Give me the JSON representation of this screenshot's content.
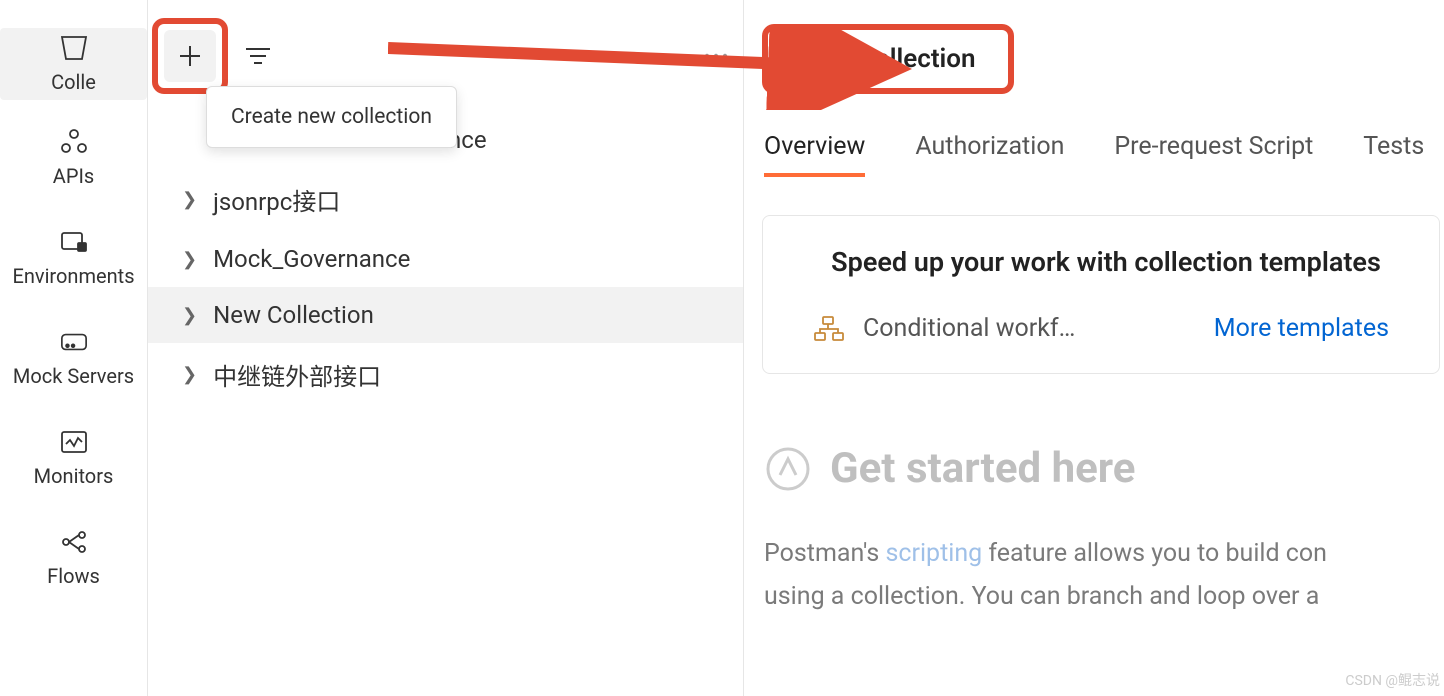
{
  "nav": {
    "items": [
      {
        "label": "Colle",
        "key": "collections"
      },
      {
        "label": "APIs",
        "key": "apis"
      },
      {
        "label": "Environments",
        "key": "environments"
      },
      {
        "label": "Mock Servers",
        "key": "mock-servers"
      },
      {
        "label": "Monitors",
        "key": "monitors"
      },
      {
        "label": "Flows",
        "key": "flows"
      }
    ]
  },
  "sidebar": {
    "tooltip": "Create new collection",
    "tree": [
      {
        "label": "nce",
        "truncated": true
      },
      {
        "label": "jsonrpc接口"
      },
      {
        "label": "Mock_Governance"
      },
      {
        "label": "New Collection",
        "selected": true
      },
      {
        "label": "中继链外部接口"
      }
    ]
  },
  "main": {
    "title": "New Collection",
    "tabs": [
      {
        "label": "Overview",
        "active": true
      },
      {
        "label": "Authorization"
      },
      {
        "label": "Pre-request Script"
      },
      {
        "label": "Tests"
      }
    ],
    "templates": {
      "title": "Speed up your work with collection templates",
      "item": "Conditional workf…",
      "more": "More templates"
    },
    "get_started": "Get started here",
    "description": {
      "pre": "Postman's ",
      "link": "scripting",
      "post": " feature allows you to build con",
      "line2": "using a collection. You can branch and loop over a "
    }
  },
  "watermark": "CSDN @鲲志说"
}
